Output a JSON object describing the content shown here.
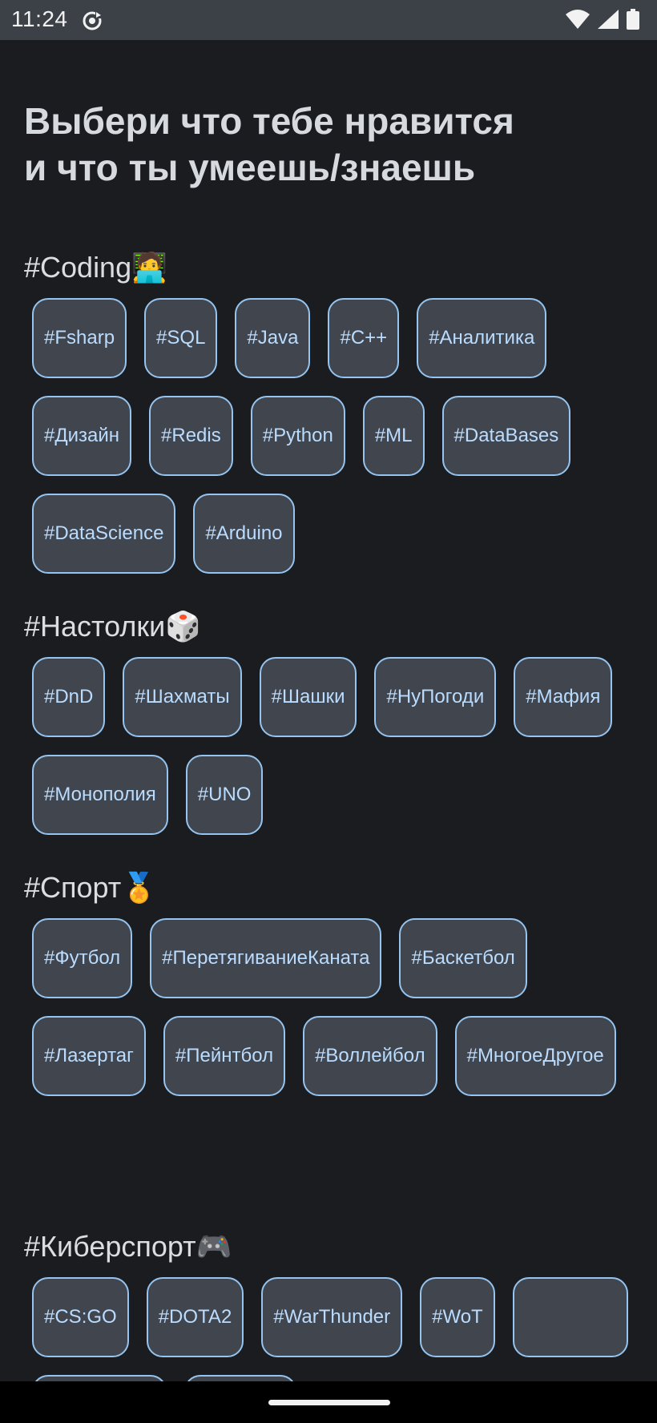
{
  "status_bar": {
    "time": "11:24"
  },
  "page": {
    "title": "Выбери что тебе нравится\nи что ты умеешь/знаешь"
  },
  "sections": [
    {
      "title": "#Coding🧑‍💻",
      "tags": [
        "#Fsharp",
        "#SQL",
        "#Java",
        "#C++",
        "#Аналитика",
        "#Дизайн",
        "#Redis",
        "#Python",
        "#ML",
        "#DataBases",
        "#DataScience",
        "#Arduino"
      ]
    },
    {
      "title": "#Настолки🎲",
      "tags": [
        "#DnD",
        "#Шахматы",
        "#Шашки",
        "#НуПогоди",
        "#Мафия",
        "#Монополия",
        "#UNO"
      ]
    },
    {
      "title": "#Спорт🏅",
      "tags": [
        "#Футбол",
        "#ПеретягиваниеКаната",
        "#Баскетбол",
        "#Лазертаг",
        "#Пейнтбол",
        "#Воллейбол",
        "#МногоеДругое"
      ]
    },
    {
      "title": "#Киберспорт🎮",
      "tags": [
        "#CS:GO",
        "#DOTA2",
        "#WarThunder",
        "#WoT"
      ]
    }
  ],
  "icons": {
    "sync": "sync-icon",
    "wifi": "wifi-icon",
    "signal": "signal-icon",
    "battery": "battery-icon"
  },
  "colors": {
    "background": "#1b1c1f",
    "status_bar": "#3c4047",
    "chip_background": "#41454d",
    "chip_border": "#94c4ef",
    "chip_text": "#b9dcff",
    "heading_text": "#d6d9de"
  }
}
